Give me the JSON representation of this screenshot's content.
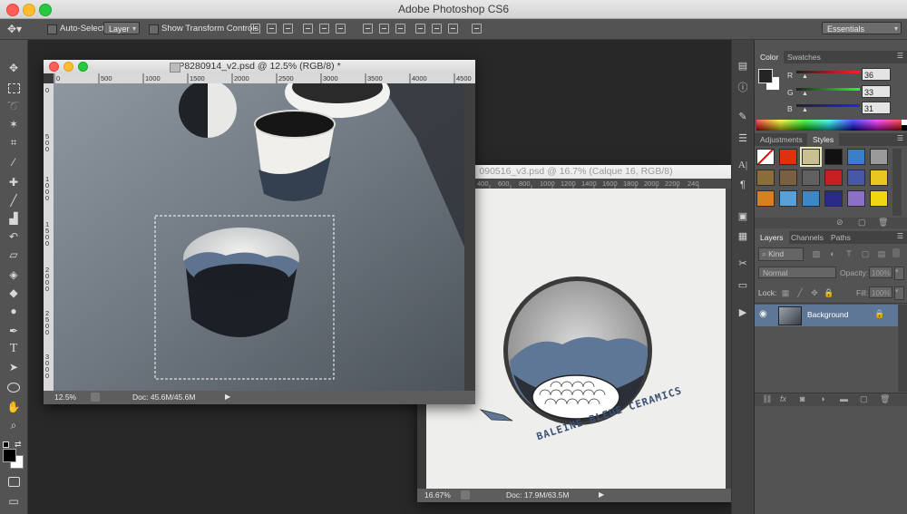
{
  "app": {
    "title": "Adobe Photoshop CS6"
  },
  "options_bar": {
    "auto_select_label": "Auto-Select:",
    "auto_select_value": "Layer",
    "show_transform_label": "Show Transform Controls",
    "workspace": "Essentials"
  },
  "documents": [
    {
      "title": "P8280914_v2.psd @ 12.5% (RGB/8) *",
      "zoom": "12.5%",
      "doc_info": "Doc: 45.6M/45.6M",
      "ruler_h": [
        "0",
        "500",
        "1000",
        "1500",
        "2000",
        "2500",
        "3000",
        "3500",
        "4000",
        "4500"
      ],
      "ruler_v": [
        "0",
        "500",
        "1000",
        "1500",
        "2000",
        "2500",
        "3000"
      ]
    },
    {
      "title": "090516_v3.psd @ 16.7% (Calque 16, RGB/8)",
      "zoom": "16.67%",
      "doc_info": "Doc: 17.9M/63.5M",
      "ruler_h": [
        "400",
        "600",
        "800",
        "1000",
        "1200",
        "1400",
        "1600",
        "1800",
        "2000",
        "2200",
        "240"
      ],
      "logo_text": "BALEINE BLEUE CERAMICS"
    }
  ],
  "color_panel": {
    "tabs": [
      "Color",
      "Swatches"
    ],
    "channels": [
      {
        "label": "R",
        "value": "36",
        "color": "#ff0000"
      },
      {
        "label": "G",
        "value": "33",
        "color": "#00cc00"
      },
      {
        "label": "B",
        "value": "31",
        "color": "#0000ff"
      }
    ]
  },
  "adjust_panel": {
    "tabs": [
      "Adjustments",
      "Styles"
    ],
    "swatch_colors": [
      "#ffffff",
      "#e03010",
      "#c8c090",
      "#111111",
      "#3a7dc8",
      "#9a9a9a",
      "#8a6e3a",
      "#7a6040",
      "#606060",
      "#c82020",
      "#4858a8",
      "#e8c820",
      "#d88020",
      "#5aa0d8",
      "#3a88c8",
      "#2a2a8a",
      "#8a70c8",
      "#f0d810"
    ]
  },
  "layers_panel": {
    "tabs": [
      "Layers",
      "Channels",
      "Paths"
    ],
    "kind_filter": "Kind",
    "blend_mode": "Normal",
    "opacity_label": "Opacity:",
    "opacity_value": "100%",
    "lock_label": "Lock:",
    "fill_label": "Fill:",
    "fill_value": "100%",
    "layers": [
      {
        "name": "Background",
        "visible": true,
        "locked": true
      }
    ]
  },
  "colors": {
    "foreground": "#000000",
    "background": "#ffffff",
    "accent_layer": "#5f7796"
  }
}
